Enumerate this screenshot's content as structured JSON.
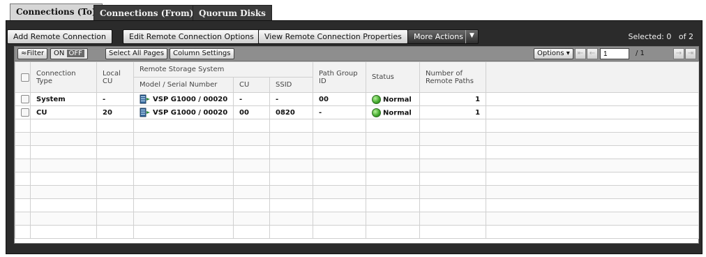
{
  "tabs": [
    {
      "label": "Connections (To)"
    },
    {
      "label": "Connections (From)"
    },
    {
      "label": "Quorum Disks"
    }
  ],
  "toolbar": {
    "add_remote_connection": "Add Remote Connection",
    "edit_remote_connection_options": "Edit Remote Connection Options",
    "view_remote_connection_properties": "View Remote Connection Properties",
    "more_actions": "More Actions",
    "more_arrow": "▼",
    "selected_label": "Selected:",
    "selected_count": "0",
    "of_label": "of",
    "total": "2"
  },
  "filterbar": {
    "filter": "≈Filter",
    "on": "ON",
    "off": "OFF",
    "select_all_pages": "Select All Pages",
    "column_settings": "Column Settings",
    "options": "Options ▾",
    "page_value": "1",
    "page_total": "/ 1"
  },
  "table": {
    "headers": {
      "connection_type": "Connection Type",
      "local_cu": "Local CU",
      "remote_storage_system": "Remote Storage System",
      "model_serial": "Model / Serial Number",
      "cu": "CU",
      "ssid": "SSID",
      "path_group_id": "Path Group ID",
      "status": "Status",
      "number_of_remote_paths": "Number of Remote Paths"
    },
    "rows": [
      {
        "connection_type": "System",
        "local_cu": "-",
        "model_serial": "VSP G1000 / 00020",
        "cu": "-",
        "ssid": "-",
        "path_group_id": "00",
        "status": "Normal",
        "remote_paths": "1"
      },
      {
        "connection_type": "CU",
        "local_cu": "20",
        "model_serial": "VSP G1000 / 00020",
        "cu": "00",
        "ssid": "0820",
        "path_group_id": "-",
        "status": "Normal",
        "remote_paths": "1"
      }
    ]
  },
  "icons": {
    "storage": "storage-system-icon",
    "status_normal": "status-normal-icon",
    "status_color": "#3fa72a"
  }
}
